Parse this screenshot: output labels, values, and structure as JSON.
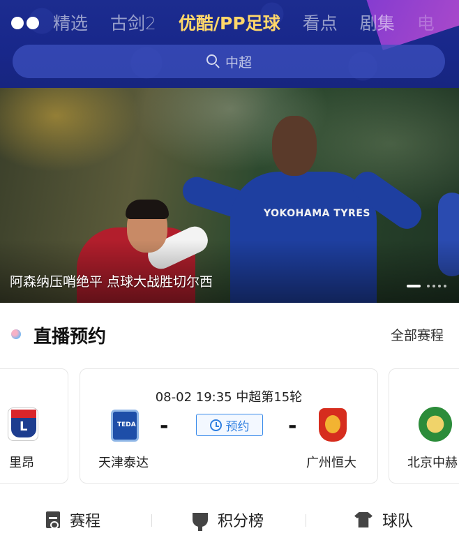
{
  "header": {
    "tabs": [
      {
        "label": "精选",
        "active": false
      },
      {
        "label": "古剑2",
        "active": false
      },
      {
        "label": "优酷/PP足球",
        "active": true
      },
      {
        "label": "看点",
        "active": false
      },
      {
        "label": "剧集",
        "active": false
      },
      {
        "label": "电",
        "active": false
      }
    ],
    "search_placeholder": "中超",
    "accent_color": "#ffd76a"
  },
  "banner": {
    "caption": "阿森纳压哨绝平 点球大战胜切尔西",
    "sponsor_text": "YOKOHAMA TYRES",
    "page_count": 5,
    "current_page": 1
  },
  "live": {
    "title": "直播预约",
    "more_label": "全部赛程"
  },
  "cards": {
    "left": {
      "team": "里昂"
    },
    "main": {
      "time": "08-02 19:35 中超第15轮",
      "home": "天津泰达",
      "away": "广州恒大",
      "home_badge": "TEDA",
      "reserve_label": "预约",
      "separator": "-"
    },
    "right": {
      "team": "北京中赫"
    }
  },
  "bottom_nav": {
    "items": [
      {
        "label": "赛程",
        "icon": "schedule-icon"
      },
      {
        "label": "积分榜",
        "icon": "trophy-icon"
      },
      {
        "label": "球队",
        "icon": "jersey-icon"
      }
    ]
  }
}
